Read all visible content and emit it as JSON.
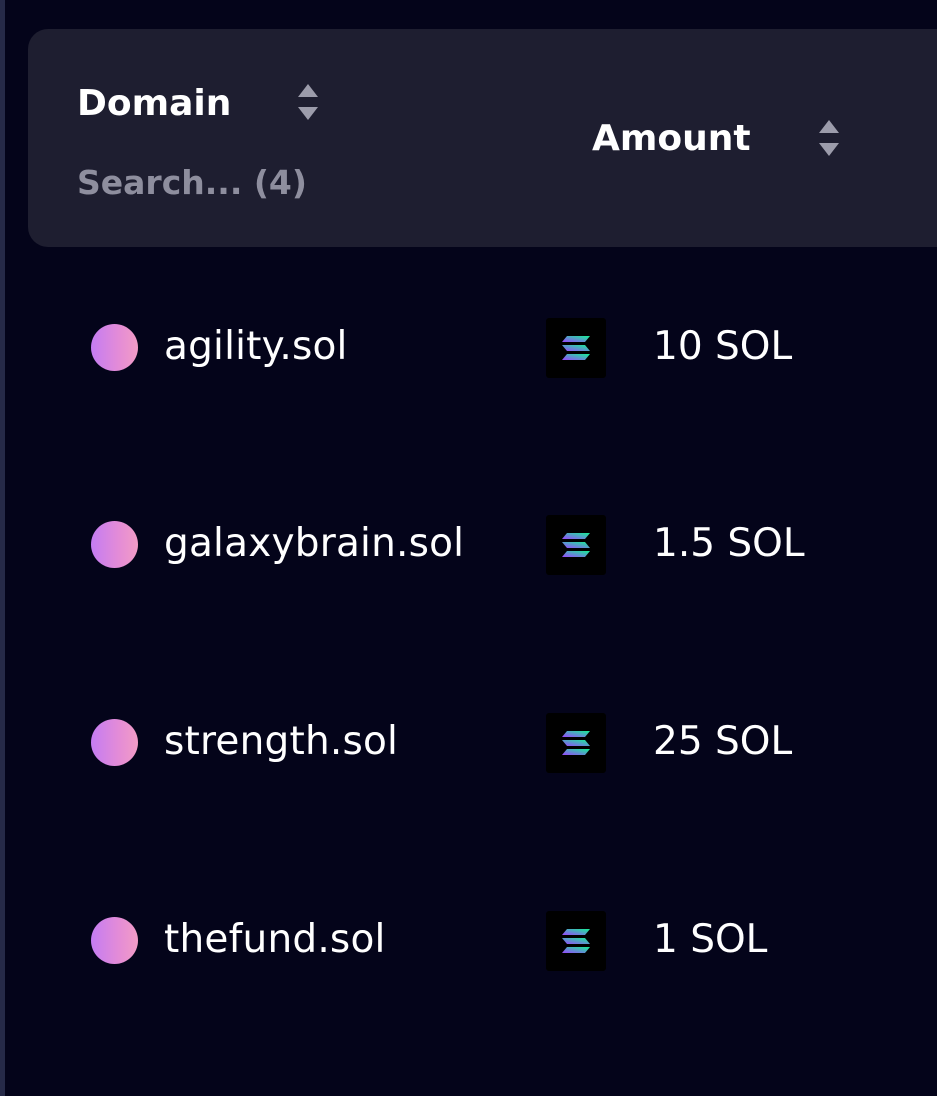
{
  "table": {
    "columns": {
      "domain": {
        "label": "Domain",
        "search_placeholder": "Search... (4)"
      },
      "amount": {
        "label": "Amount"
      }
    },
    "rows": [
      {
        "domain": "agility.sol",
        "token_icon": "solana-icon",
        "amount": "10 SOL"
      },
      {
        "domain": "galaxybrain.sol",
        "token_icon": "solana-icon",
        "amount": "1.5 SOL"
      },
      {
        "domain": "strength.sol",
        "token_icon": "solana-icon",
        "amount": "25 SOL"
      },
      {
        "domain": "thefund.sol",
        "token_icon": "solana-icon",
        "amount": "1 SOL"
      }
    ]
  },
  "colors": {
    "background": "#04041a",
    "header_background": "#1e1e30",
    "muted_text": "#8e8e9e",
    "avatar_gradient_start": "#c47cf3",
    "avatar_gradient_end": "#f29cc6",
    "solana_gradient_start": "#9945ff",
    "solana_gradient_end": "#14f195"
  }
}
